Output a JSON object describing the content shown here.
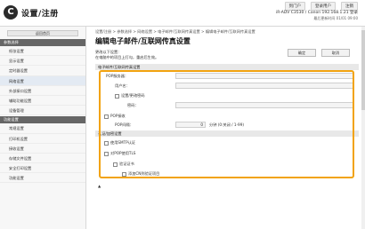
{
  "header": {
    "app_title": "设置/注册",
    "logo_glyph": "C",
    "links": [
      "到门户",
      "登录用户",
      "注销"
    ],
    "device_info": "iR-ADV C3530 / Canon 192.168.1.21 登录",
    "status_line": "最后更新时间 01/01 09:00"
  },
  "sidebar": {
    "home_label": "返回首页",
    "groups": [
      {
        "title": "参数选择",
        "items": [
          "纸张设置",
          "显示设置",
          "定时器设置",
          "网络设置",
          "外部接口设置",
          "辅助功能设置",
          "设备管理"
        ]
      },
      {
        "title": "功能设置",
        "items": [
          "常规设置",
          "打印机设置",
          "接收设置",
          "存储文件设置",
          "安全打印设置",
          "功能设置"
        ]
      }
    ]
  },
  "main": {
    "breadcrumb": "设置/注册 > 参数选择 > 网络设置 > 电子邮件/互联网传真设置 > 编辑电子邮件/互联网传真设置",
    "title": "编辑电子邮件/互联网传真设置",
    "desc_line1": "更改以下设置：",
    "desc_line2": "在电脑中的项目上打勾，重启后生效。",
    "ok_label": "确定",
    "cancel_label": "取消",
    "section1_title": "电子邮件/互联网传真设置",
    "pop3_server_label": "POP服务器：",
    "user_name_label": "用户名：",
    "set_password_label": "设置/更改密码",
    "password_label": "密码：",
    "pop_receive_label": "POP接收",
    "pop_interval_label": "POP间隔：",
    "pop_interval_value": "0",
    "pop_interval_unit": "分钟 (0:关闭 / 1-99)",
    "section2_title": "认证/加密设置",
    "auth_smtp_label": "使用SMTP认证",
    "tls_label": "对POP使用TLS",
    "verify_cert_label": "验证证书",
    "add_cn_label": "添加CN到验证项目",
    "footer_mark": "▲"
  },
  "colors": {
    "highlight": "#f2a30f",
    "group_bar": "#666666",
    "active_item": "#e3eaf3"
  }
}
